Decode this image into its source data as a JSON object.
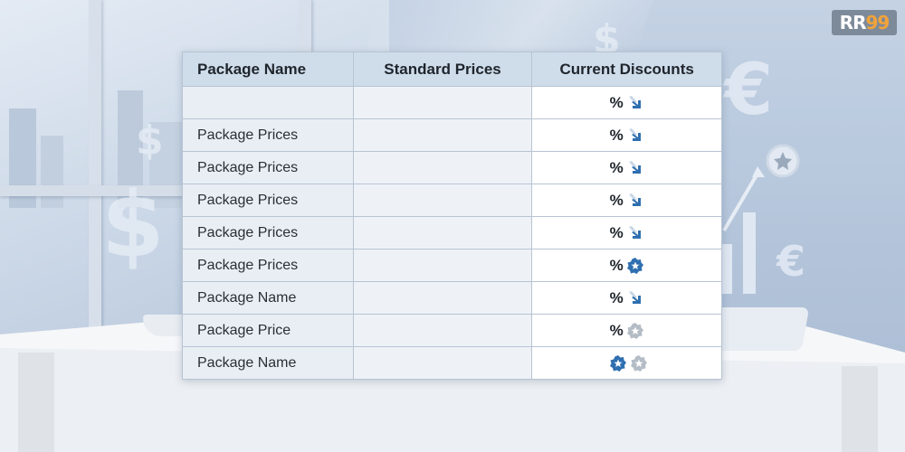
{
  "logo": {
    "text_a": "RR",
    "text_b": "99"
  },
  "table": {
    "headers": [
      "Package Name",
      "Standard Prices",
      "Current Discounts"
    ],
    "rows": [
      {
        "name": "",
        "standard": "",
        "discount_symbol": "%",
        "icons": [
          "arrow-down-icon"
        ]
      },
      {
        "name": "Package Prices",
        "standard": "",
        "discount_symbol": "%",
        "icons": [
          "arrow-down-icon"
        ]
      },
      {
        "name": "Package Prices",
        "standard": "",
        "discount_symbol": "%",
        "icons": [
          "arrow-down-icon"
        ]
      },
      {
        "name": "Package Prices",
        "standard": "",
        "discount_symbol": "%",
        "icons": [
          "arrow-down-icon"
        ]
      },
      {
        "name": "Package Prices",
        "standard": "",
        "discount_symbol": "%",
        "icons": [
          "arrow-down-icon"
        ]
      },
      {
        "name": "Package Prices",
        "standard": "",
        "discount_symbol": "%",
        "icons": [
          "badge-blue-icon"
        ]
      },
      {
        "name": "Package Name",
        "standard": "",
        "discount_symbol": "%",
        "icons": [
          "arrow-down-icon"
        ]
      },
      {
        "name": "Package Price",
        "standard": "",
        "discount_symbol": "%",
        "icons": [
          "badge-gray-icon"
        ]
      },
      {
        "name": "Package Name",
        "standard": "",
        "discount_symbol": "",
        "icons": [
          "badge-blue-icon",
          "badge-gray-icon"
        ]
      }
    ]
  },
  "colors": {
    "header_bg": "#cfdcea",
    "icon_blue": "#2f6fb0",
    "icon_gray": "#b4bcc6"
  }
}
